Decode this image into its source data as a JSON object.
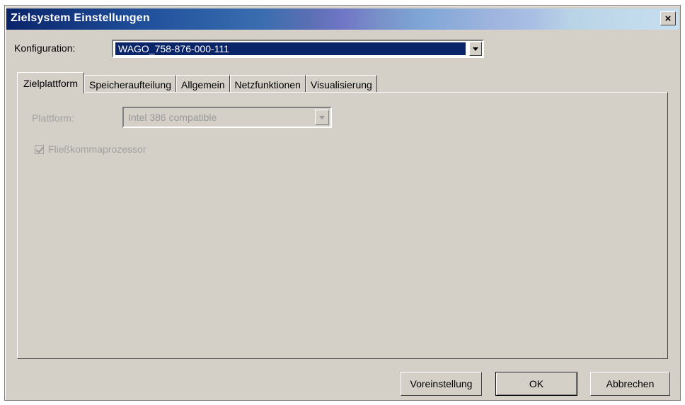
{
  "window": {
    "title": "Zielsystem Einstellungen",
    "close_label": "×"
  },
  "configuration": {
    "label": "Konfiguration:",
    "value": "WAGO_758-876-000-111"
  },
  "tabs": [
    {
      "label": "Zielplattform",
      "active": true
    },
    {
      "label": "Speicheraufteilung",
      "active": false
    },
    {
      "label": "Allgemein",
      "active": false
    },
    {
      "label": "Netzfunktionen",
      "active": false
    },
    {
      "label": "Visualisierung",
      "active": false
    }
  ],
  "panel": {
    "platform_label": "Plattform:",
    "platform_value": "Intel 386 compatible",
    "fpu_label": "Fließkommaprozessor",
    "fpu_checked": true,
    "disabled": true
  },
  "buttons": {
    "preset": "Voreinstellung",
    "ok": "OK",
    "cancel": "Abbrechen"
  },
  "colors": {
    "dialog_bg": "#d4d0c8",
    "title_bg": "#0a246a",
    "selection_bg": "#0a246a",
    "disabled_text": "#a0a0a0"
  }
}
